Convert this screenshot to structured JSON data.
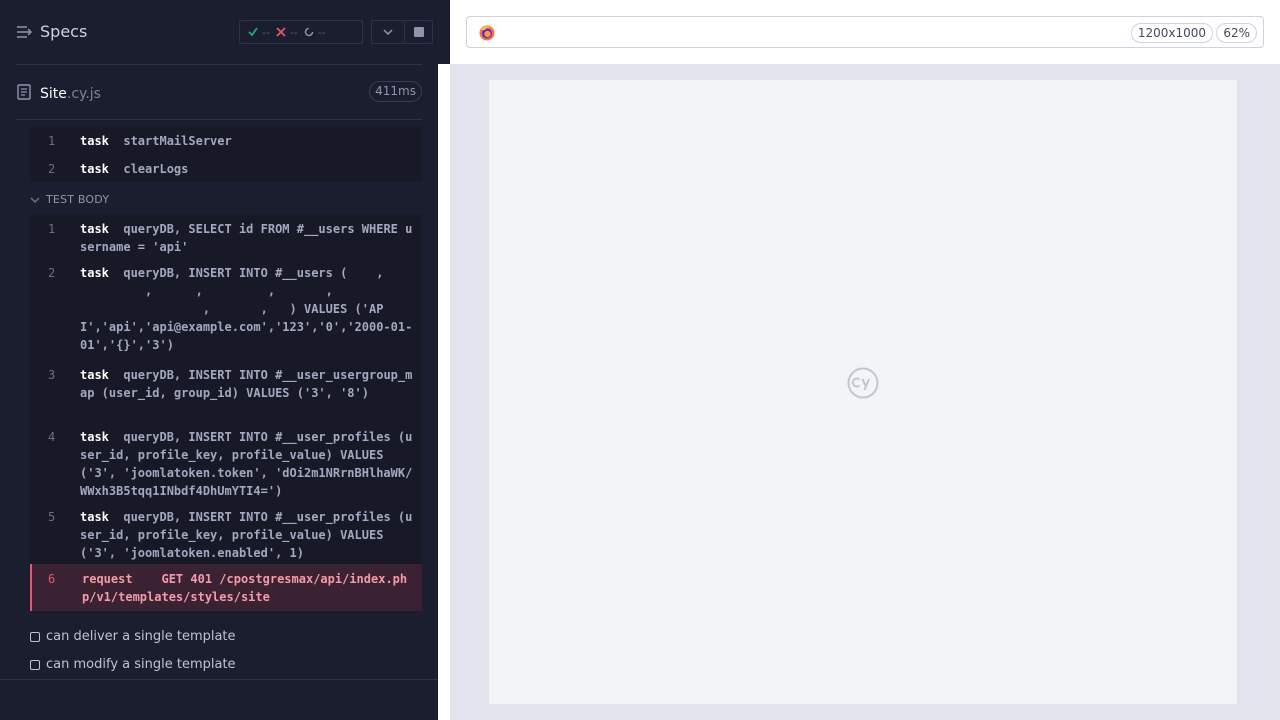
{
  "header": {
    "title": "Specs"
  },
  "stats": {
    "passed": "--",
    "failed": "--",
    "pending": "--"
  },
  "file": {
    "name": "Site",
    "ext": ".cy.js",
    "duration": "411ms"
  },
  "before_hooks": [
    {
      "n": "1",
      "cmd": "task",
      "msg": "startMailServer"
    },
    {
      "n": "2",
      "cmd": "task",
      "msg": "clearLogs"
    }
  ],
  "section": {
    "label": "TEST BODY"
  },
  "test_body": [
    {
      "n": "1",
      "cmd": "task",
      "msg": "queryDB, SELECT id FROM #__users WHERE username = 'api'"
    },
    {
      "n": "2",
      "cmd": "task",
      "msg": "queryDB, INSERT INTO #__users (    ,\n         ,      ,         ,       ,\n                 ,       ,   ) VALUES ('API','api','api@example.com','123','0','2000-01-01','{}','3')"
    },
    {
      "n": "3",
      "cmd": "task",
      "msg": "queryDB, INSERT INTO #__user_usergroup_map (user_id, group_id) VALUES ('3', '8')"
    },
    {
      "n": "4",
      "cmd": "task",
      "msg": "queryDB, INSERT INTO #__user_profiles (user_id, profile_key, profile_value) VALUES ('3', 'joomlatoken.token', 'dOi2m1NRrnBHlhaWK/WWxh3B5tqq1INbdf4DhUmYTI4=')"
    },
    {
      "n": "5",
      "cmd": "task",
      "msg": "queryDB, INSERT INTO #__user_profiles (user_id, profile_key, profile_value) VALUES ('3', 'joomlatoken.enabled', 1)"
    },
    {
      "n": "6",
      "cmd": "request",
      "msg": "   GET 401 /cpostgresmax/api/index.php/v1/templates/styles/site"
    }
  ],
  "tests": [
    {
      "label": "can deliver a single template"
    },
    {
      "label": "can modify a single template"
    }
  ],
  "browser": {
    "viewport_size": "1200x1000",
    "zoom": "62%"
  },
  "colors": {
    "accent_pass": "#1fa971",
    "accent_fail": "#e45770",
    "error_bg": "#3a2233"
  }
}
